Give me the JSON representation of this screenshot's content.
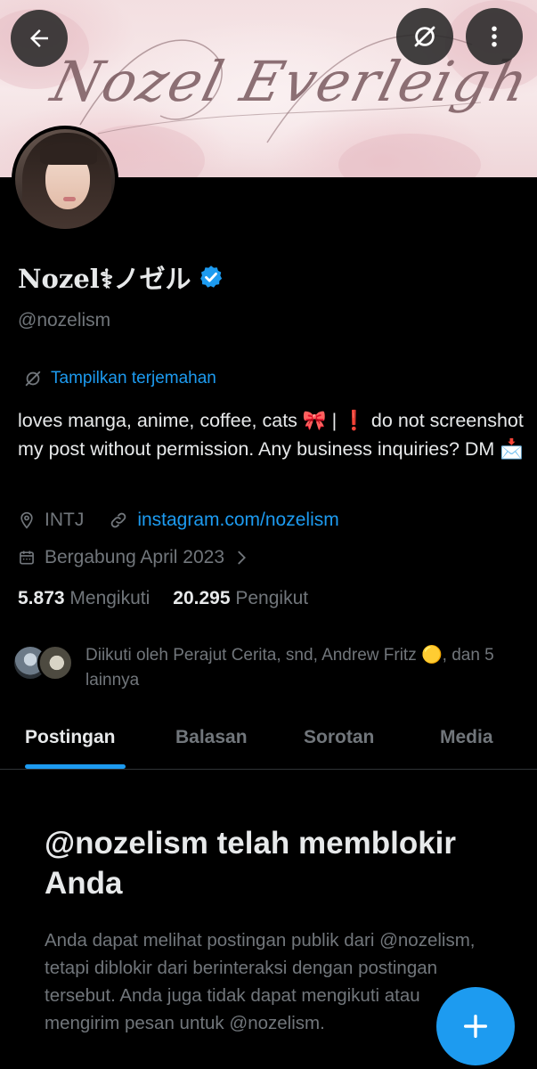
{
  "profile": {
    "display_name": "Nozel⚕ノゼル",
    "handle": "@nozelism",
    "banner_text": "Nozel Everleigh",
    "verified_color": "#1d9bf0"
  },
  "translate": {
    "label": "Tampilkan terjemahan"
  },
  "bio": {
    "text": "loves manga, anime, coffee, cats 🎀 | ❗ do not screenshot my post without permission. Any business inquiries? DM 📩"
  },
  "meta": {
    "location": "INTJ",
    "website": "instagram.com/nozelism",
    "joined": "Bergabung April 2023"
  },
  "stats": {
    "following_count": "5.873",
    "following_label": "Mengikuti",
    "followers_count": "20.295",
    "followers_label": "Pengikut"
  },
  "followed_by": {
    "text": "Diikuti oleh Perajut Cerita, snd, Andrew Fritz 🟡, dan 5 lainnya"
  },
  "tabs": [
    {
      "label": "Postingan",
      "active": true
    },
    {
      "label": "Balasan",
      "active": false
    },
    {
      "label": "Sorotan",
      "active": false
    },
    {
      "label": "Media",
      "active": false
    }
  ],
  "blocked": {
    "title": "@nozelism telah memblokir Anda",
    "body": "Anda dapat melihat postingan publik dari @nozelism, tetapi diblokir dari berinteraksi dengan postingan tersebut. Anda juga tidak dapat mengikuti atau mengirim pesan untuk @nozelism."
  },
  "icons": {
    "back": "arrow-left-icon",
    "translate": "no-translate-icon",
    "more": "more-vertical-icon",
    "location": "location-pin-icon",
    "link": "link-icon",
    "calendar": "calendar-icon",
    "compose": "plus-icon"
  },
  "colors": {
    "accent": "#1d9bf0",
    "muted": "#71767b",
    "text": "#e7e9ea",
    "background": "#000000"
  }
}
